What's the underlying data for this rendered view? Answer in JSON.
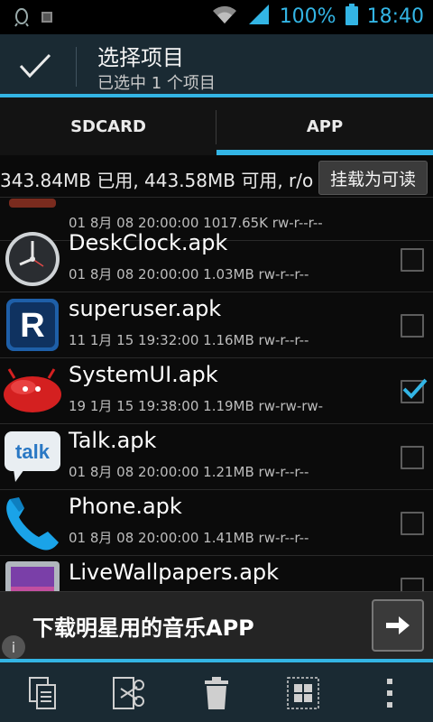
{
  "status_bar": {
    "battery": "100%",
    "time": "18:40",
    "accent": "#33b5e5"
  },
  "action_bar": {
    "title": "选择项目",
    "subtitle": "已选中 1 个项目"
  },
  "tabs": [
    {
      "label": "SDCARD"
    },
    {
      "label": "APP",
      "selected": true
    }
  ],
  "storage": {
    "info": "343.84MB 已用, 443.58MB 可用, r/o",
    "button": "挂载为可读"
  },
  "files": [
    {
      "name": "",
      "meta": "01 8月 08 20:00:00  1017.65K  rw-r--r--",
      "icon": "partial-app-icon",
      "checked": false,
      "partial": true
    },
    {
      "name": "DeskClock.apk",
      "meta": "01 8月 08 20:00:00  1.03MB  rw-r--r--",
      "icon": "clock-icon",
      "checked": false
    },
    {
      "name": "superuser.apk",
      "meta": "11 1月 15 19:32:00  1.16MB  rw-r--r--",
      "icon": "superuser-icon",
      "checked": false
    },
    {
      "name": "SystemUI.apk",
      "meta": "19 1月 15 19:38:00  1.19MB  rw-rw-rw-",
      "icon": "jellybean-icon",
      "checked": true
    },
    {
      "name": "Talk.apk",
      "meta": "01 8月 08 20:00:00  1.21MB  rw-r--r--",
      "icon": "talk-icon",
      "checked": false
    },
    {
      "name": "Phone.apk",
      "meta": "01 8月 08 20:00:00  1.41MB  rw-r--r--",
      "icon": "phone-icon",
      "checked": false
    },
    {
      "name": "LiveWallpapers.apk",
      "meta": "",
      "icon": "wallpaper-icon",
      "checked": false
    }
  ],
  "ad": {
    "text": "下载明星用的音乐APP",
    "info": "i"
  },
  "bottom_bar": [
    {
      "icon": "copy-icon"
    },
    {
      "icon": "cut-icon"
    },
    {
      "icon": "delete-icon"
    },
    {
      "icon": "select-all-icon"
    },
    {
      "icon": "more-icon"
    }
  ]
}
